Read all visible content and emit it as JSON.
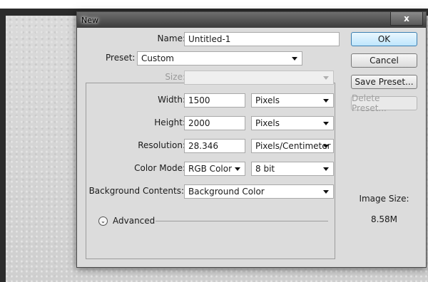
{
  "window": {
    "title": "New",
    "close_glyph": "x"
  },
  "form": {
    "name": {
      "label": "Name:",
      "value": "Untitled-1"
    },
    "preset": {
      "label": "Preset:",
      "value": "Custom"
    },
    "size": {
      "label": "Size:",
      "value": ""
    },
    "width": {
      "label": "Width:",
      "value": "1500",
      "unit": "Pixels"
    },
    "height": {
      "label": "Height:",
      "value": "2000",
      "unit": "Pixels"
    },
    "resolution": {
      "label": "Resolution:",
      "value": "28.346",
      "unit": "Pixels/Centimeter"
    },
    "color_mode": {
      "label": "Color Mode:",
      "value": "RGB Color",
      "depth": "8 bit"
    },
    "background": {
      "label": "Background Contents:",
      "value": "Background Color"
    },
    "advanced": {
      "label": "Advanced",
      "icon": "chevron-down-circle-icon"
    }
  },
  "buttons": {
    "ok": "OK",
    "cancel": "Cancel",
    "save_preset": "Save Preset...",
    "delete_preset": "Delete Preset..."
  },
  "image_size": {
    "label": "Image Size:",
    "value": "8.58M"
  }
}
